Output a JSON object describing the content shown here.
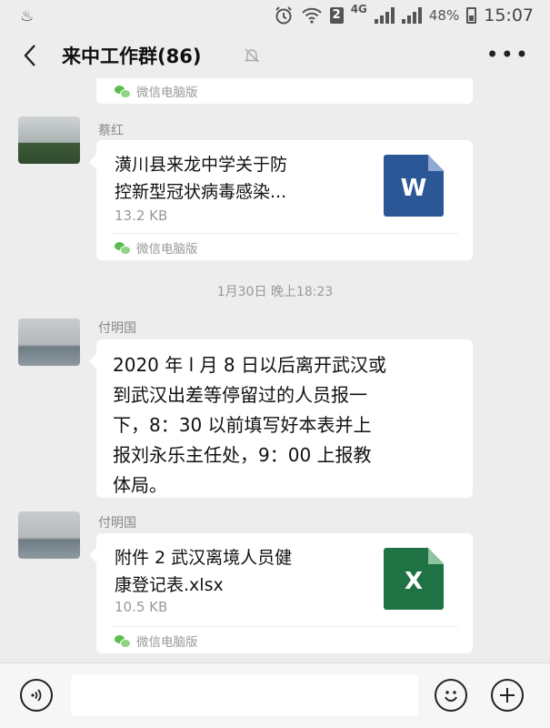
{
  "status_bar": {
    "sim_badge": "2",
    "network": "4G",
    "battery": "48%",
    "time": "15:07",
    "icons": [
      "notification-icon",
      "alarm-icon",
      "wifi-icon",
      "signal-icon",
      "battery-icon"
    ]
  },
  "header": {
    "title": "来中工作群(86)",
    "icons": [
      "back-icon",
      "mute-icon",
      "more-icon"
    ]
  },
  "messages": [
    {
      "type": "file-partial",
      "source": "微信电脑版"
    },
    {
      "type": "file",
      "sender": "蔡红",
      "file_name_line1": "潢川县来龙中学关于防",
      "file_name_line2": "控新型冠状病毒感染...",
      "size": "13.2 KB",
      "icon_letter": "W",
      "icon_color": "#2b5797",
      "source": "微信电脑版"
    },
    {
      "type": "timestamp",
      "text": "1月30日 晚上18:23"
    },
    {
      "type": "text",
      "sender": "付明国",
      "lines": [
        "2020 年 l 月 8 日以后离开武汉或",
        "到武汉出差等停留过的人员报一",
        "下，8：30 以前填写好本表并上",
        "报刘永乐主任处，9：00 上报教",
        "体局。"
      ]
    },
    {
      "type": "file",
      "sender": "付明国",
      "file_name_line1": "附件 2 武汉离境人员健",
      "file_name_line2": "康登记表.xlsx",
      "size": "10.5 KB",
      "icon_letter": "X",
      "icon_color": "#1f7244",
      "source": "微信电脑版"
    }
  ],
  "input_bar": {
    "text_value": "",
    "icons": [
      "voice-icon",
      "emoji-icon",
      "plus-icon"
    ]
  }
}
